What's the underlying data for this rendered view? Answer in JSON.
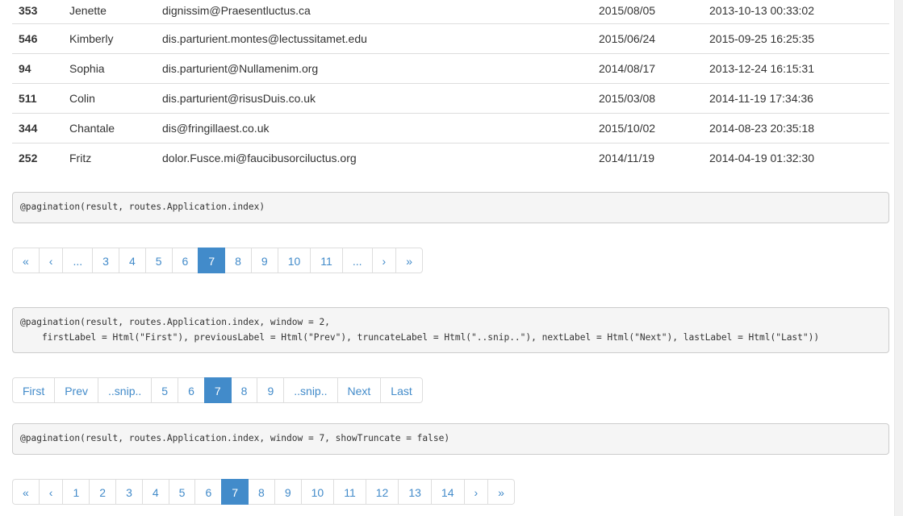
{
  "table": {
    "rows": [
      {
        "id": "353",
        "name": "Jenette",
        "email": "dignissim@Praesentluctus.ca",
        "date": "2015/08/05",
        "timestamp": "2013-10-13 00:33:02"
      },
      {
        "id": "546",
        "name": "Kimberly",
        "email": "dis.parturient.montes@lectussitamet.edu",
        "date": "2015/06/24",
        "timestamp": "2015-09-25 16:25:35"
      },
      {
        "id": "94",
        "name": "Sophia",
        "email": "dis.parturient@Nullamenim.org",
        "date": "2014/08/17",
        "timestamp": "2013-12-24 16:15:31"
      },
      {
        "id": "511",
        "name": "Colin",
        "email": "dis.parturient@risusDuis.co.uk",
        "date": "2015/03/08",
        "timestamp": "2014-11-19 17:34:36"
      },
      {
        "id": "344",
        "name": "Chantale",
        "email": "dis@fringillaest.co.uk",
        "date": "2015/10/02",
        "timestamp": "2014-08-23 20:35:18"
      },
      {
        "id": "252",
        "name": "Fritz",
        "email": "dolor.Fusce.mi@faucibusorciluctus.org",
        "date": "2014/11/19",
        "timestamp": "2014-04-19 01:32:30"
      }
    ]
  },
  "examples": [
    {
      "code": "@pagination(result, routes.Application.index)",
      "active": "7",
      "pages": [
        "«",
        "‹",
        "...",
        "3",
        "4",
        "5",
        "6",
        "7",
        "8",
        "9",
        "10",
        "11",
        "...",
        "›",
        "»"
      ]
    },
    {
      "code": "@pagination(result, routes.Application.index, window = 2,\n    firstLabel = Html(\"First\"), previousLabel = Html(\"Prev\"), truncateLabel = Html(\"..snip..\"), nextLabel = Html(\"Next\"), lastLabel = Html(\"Last\"))",
      "active": "7",
      "pages": [
        "First",
        "Prev",
        "..snip..",
        "5",
        "6",
        "7",
        "8",
        "9",
        "..snip..",
        "Next",
        "Last"
      ]
    },
    {
      "code": "@pagination(result, routes.Application.index, window = 7, showTruncate = false)",
      "active": "7",
      "pages": [
        "«",
        "‹",
        "1",
        "2",
        "3",
        "4",
        "5",
        "6",
        "7",
        "8",
        "9",
        "10",
        "11",
        "12",
        "13",
        "14",
        "›",
        "»"
      ]
    }
  ],
  "colors": {
    "accent": "#428bca",
    "link": "#428bca",
    "muted": "#999999"
  }
}
